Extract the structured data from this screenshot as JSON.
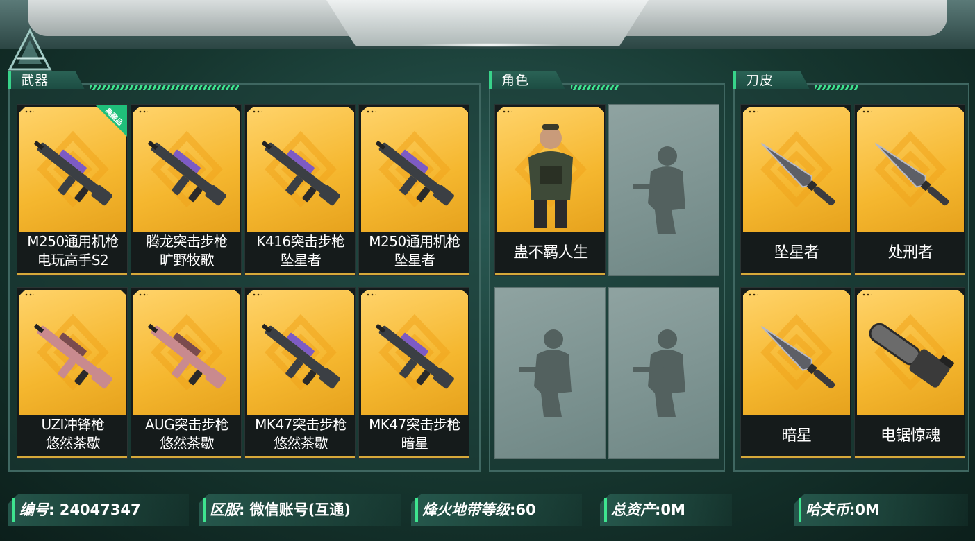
{
  "sections": {
    "weapons": {
      "title": "武器",
      "items": [
        {
          "line1": "M250通用机枪",
          "line2": "电玩高手S2",
          "badge": "典藏品",
          "icon": "machine-gun-icon"
        },
        {
          "line1": "腾龙突击步枪",
          "line2": "旷野牧歌",
          "icon": "assault-rifle-icon"
        },
        {
          "line1": "K416突击步枪",
          "line2": "坠星者",
          "icon": "assault-rifle-icon"
        },
        {
          "line1": "M250通用机枪",
          "line2": "坠星者",
          "icon": "machine-gun-icon"
        },
        {
          "line1": "UZI冲锋枪",
          "line2": "悠然茶歇",
          "icon": "smg-icon"
        },
        {
          "line1": "AUG突击步枪",
          "line2": "悠然茶歇",
          "icon": "bullpup-rifle-icon"
        },
        {
          "line1": "MK47突击步枪",
          "line2": "悠然茶歇",
          "icon": "assault-rifle-icon"
        },
        {
          "line1": "MK47突击步枪",
          "line2": "暗星",
          "icon": "assault-rifle-icon"
        }
      ]
    },
    "characters": {
      "title": "角色",
      "items": [
        {
          "name": "蛊不羁人生",
          "icon": "operator-character-icon"
        }
      ],
      "empty_slots": 3
    },
    "knives": {
      "title": "刀皮",
      "items": [
        {
          "name": "坠星者",
          "icon": "knife-icon"
        },
        {
          "name": "处刑者",
          "icon": "combat-knife-icon"
        },
        {
          "name": "暗星",
          "icon": "blade-icon"
        },
        {
          "name": "电锯惊魂",
          "icon": "chainsaw-icon"
        }
      ]
    }
  },
  "footer": {
    "id_label": "编号",
    "id_value": "24047347",
    "server_label": "区服",
    "server_value": "微信账号(互通)",
    "level_label": "烽火地带等级",
    "level_value": "60",
    "assets_label": "总资产",
    "assets_value": "0M",
    "coin_label": "哈夫币",
    "coin_value": "0M",
    "separator": ":"
  },
  "colors": {
    "accent_green": "#3ee48f",
    "card_gold": "#f5b72f",
    "background": "#16362f"
  }
}
